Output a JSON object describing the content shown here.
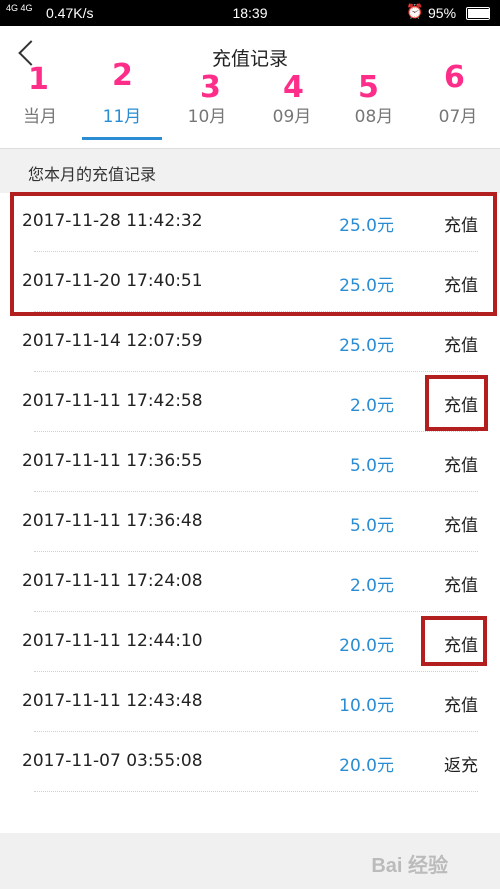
{
  "status": {
    "signal": "4G 4G",
    "speed": "0.47K/s",
    "time": "18:39",
    "alarm_icon": "alarm-clock-icon",
    "battery": "95%",
    "battery_level": 0.95
  },
  "header": {
    "title": "充值记录"
  },
  "tabs": [
    {
      "label": "当月",
      "annotation": "1"
    },
    {
      "label": "11月",
      "annotation": "2",
      "active": true
    },
    {
      "label": "10月",
      "annotation": "3"
    },
    {
      "label": "09月",
      "annotation": "4"
    },
    {
      "label": "08月",
      "annotation": "5"
    },
    {
      "label": "07月",
      "annotation": "6"
    }
  ],
  "section_title": "您本月的充值记录",
  "records": [
    {
      "date": "2017-11-28 11:42:32",
      "amount": "25.0元",
      "type": "充值"
    },
    {
      "date": "2017-11-20 17:40:51",
      "amount": "25.0元",
      "type": "充值"
    },
    {
      "date": "2017-11-14 12:07:59",
      "amount": "25.0元",
      "type": "充值"
    },
    {
      "date": "2017-11-11 17:42:58",
      "amount": "2.0元",
      "type": "充值"
    },
    {
      "date": "2017-11-11 17:36:55",
      "amount": "5.0元",
      "type": "充值"
    },
    {
      "date": "2017-11-11 17:36:48",
      "amount": "5.0元",
      "type": "充值"
    },
    {
      "date": "2017-11-11 17:24:08",
      "amount": "2.0元",
      "type": "充值"
    },
    {
      "date": "2017-11-11 12:44:10",
      "amount": "20.0元",
      "type": "充值"
    },
    {
      "date": "2017-11-11 12:43:48",
      "amount": "10.0元",
      "type": "充值"
    },
    {
      "date": "2017-11-07 03:55:08",
      "amount": "20.0元",
      "type": "返充"
    }
  ],
  "colors": {
    "accent": "#2a8dd4",
    "annotation": "#ff2d8a",
    "highlight_box": "#b31e1e"
  },
  "watermark": "Bai 经验"
}
